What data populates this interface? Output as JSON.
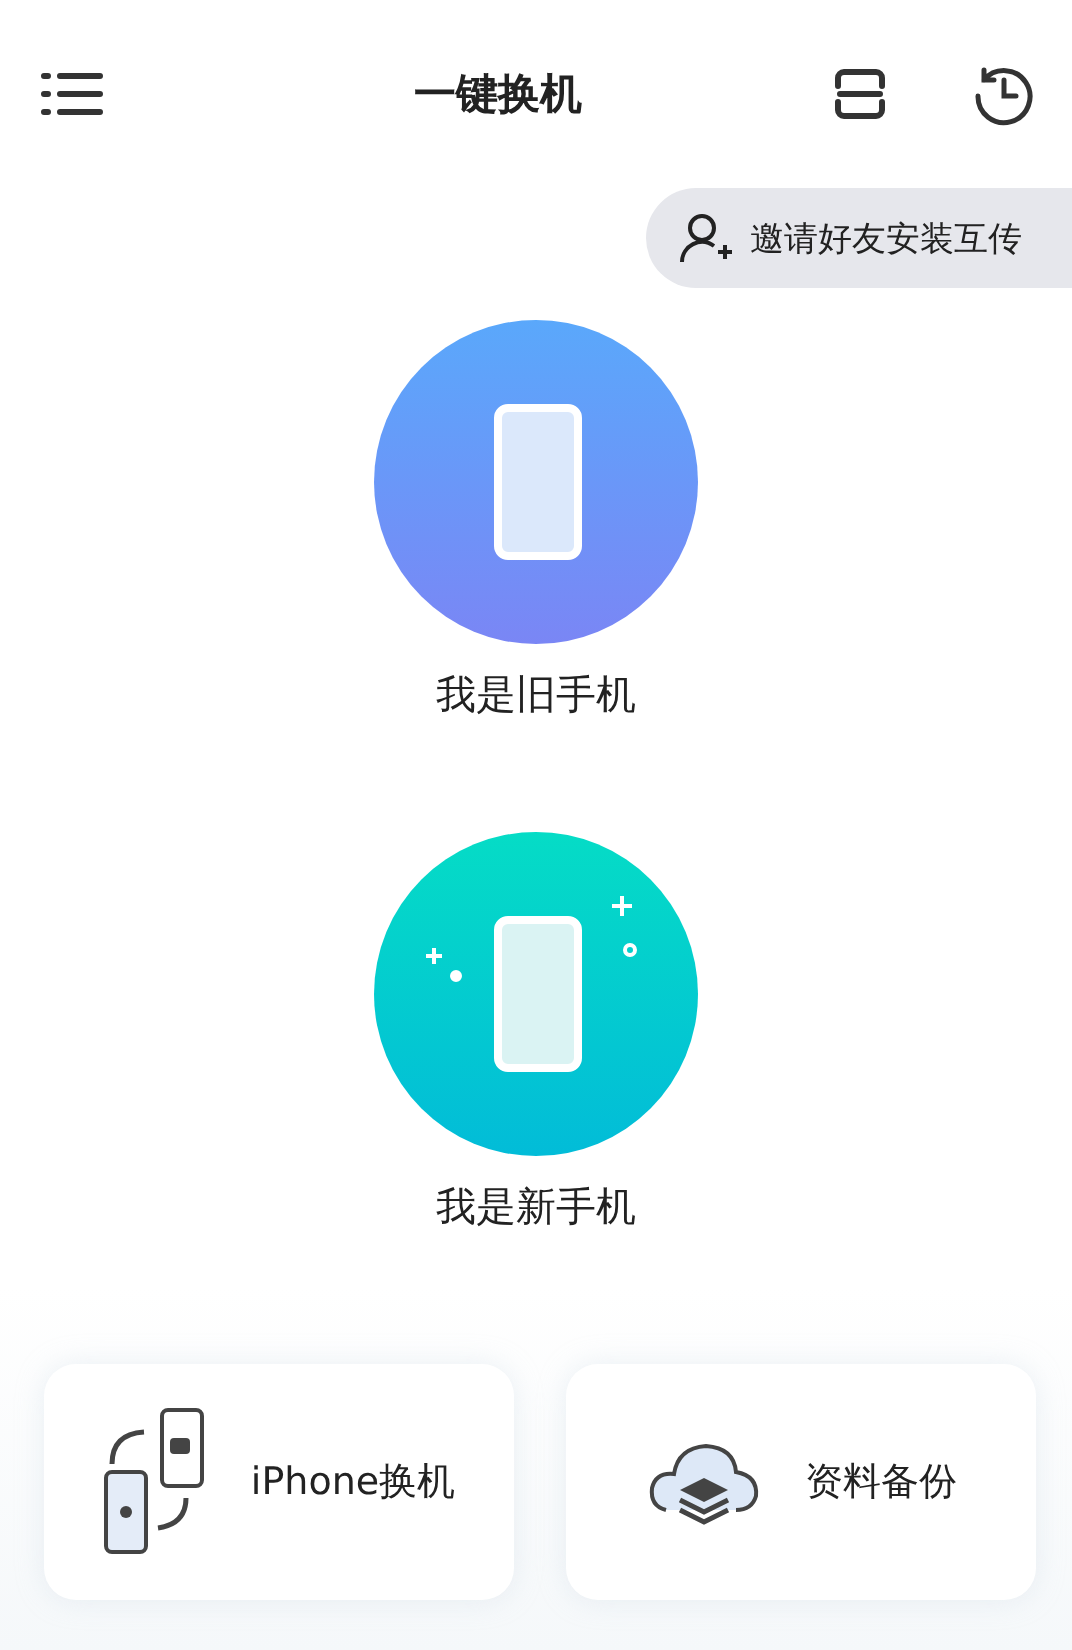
{
  "header": {
    "title": "一键换机"
  },
  "invite": {
    "label": "邀请好友安装互传"
  },
  "roles": [
    {
      "kind": "old",
      "label": "我是旧手机"
    },
    {
      "kind": "new",
      "label": "我是新手机"
    }
  ],
  "cards": [
    {
      "kind": "transfer",
      "label": "iPhone换机"
    },
    {
      "kind": "backup",
      "label": "资料备份"
    }
  ]
}
